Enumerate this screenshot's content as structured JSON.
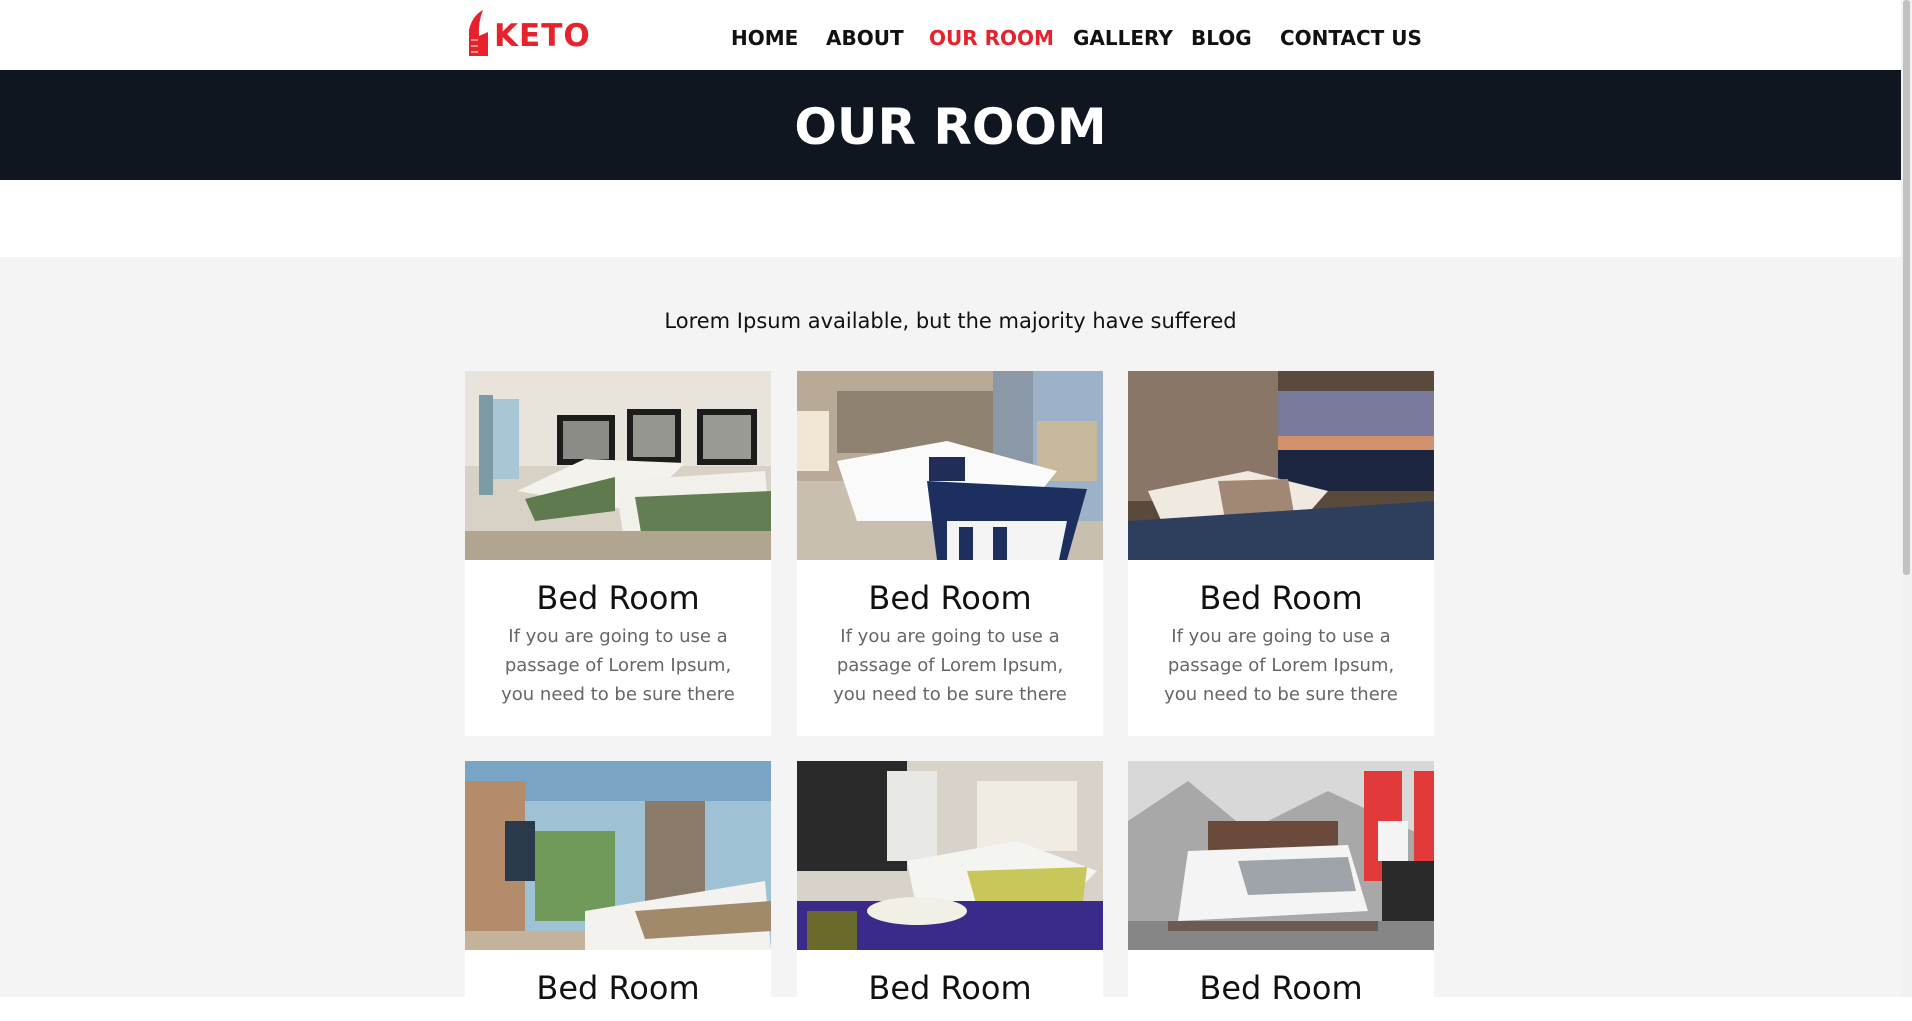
{
  "brand": {
    "logo_text": "KETO",
    "accent": "#e6222d"
  },
  "nav": [
    {
      "label": "HOME",
      "active": false
    },
    {
      "label": "ABOUT",
      "active": false
    },
    {
      "label": "OUR ROOM",
      "active": true
    },
    {
      "label": "GALLERY",
      "active": false
    },
    {
      "label": "BLOG",
      "active": false
    },
    {
      "label": "CONTACT US",
      "active": false
    }
  ],
  "banner": {
    "title": "OUR ROOM",
    "background": "#0f1620"
  },
  "rooms_section": {
    "subtitle": "Lorem Ipsum available, but the majority have suffered",
    "cards": [
      {
        "title": "Bed Room",
        "text": "If you are going to use a passage of Lorem Ipsum, you need to be sure there",
        "image": "twin-beds-green-bedding"
      },
      {
        "title": "Bed Room",
        "text": "If you are going to use a passage of Lorem Ipsum, you need to be sure there",
        "image": "bed-navy-blanket-city-window"
      },
      {
        "title": "Bed Room",
        "text": "If you are going to use a passage of Lorem Ipsum, you need to be sure there",
        "image": "bed-dusk-city-view"
      },
      {
        "title": "Bed Room",
        "text": "",
        "image": "bright-room-garden-balcony"
      },
      {
        "title": "Bed Room",
        "text": "",
        "image": "room-purple-carpet-lounge"
      },
      {
        "title": "Bed Room",
        "text": "",
        "image": "bed-mountain-mural-red-door"
      }
    ]
  }
}
